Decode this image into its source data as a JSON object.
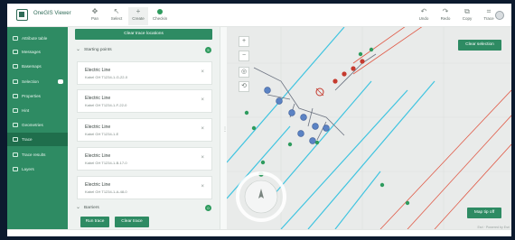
{
  "app": {
    "title": "OneGIS Viewer"
  },
  "toolbar": {
    "tools": [
      {
        "label": "Pan",
        "icon": "pan-icon"
      },
      {
        "label": "Select",
        "icon": "select-icon"
      },
      {
        "label": "Create",
        "icon": "create-icon"
      },
      {
        "label": "Checkin",
        "icon": "checkin-icon"
      }
    ],
    "right_tools": [
      {
        "label": "Undo",
        "icon": "undo-icon"
      },
      {
        "label": "Redo",
        "icon": "redo-icon"
      },
      {
        "label": "Copy",
        "icon": "copy-icon"
      },
      {
        "label": "Trace",
        "icon": "trace-icon"
      }
    ]
  },
  "sidebar": {
    "items": [
      {
        "label": "Attribute table",
        "active": false
      },
      {
        "label": "Messages",
        "active": false
      },
      {
        "label": "Basemaps",
        "active": false
      },
      {
        "label": "Selection",
        "active": false
      },
      {
        "label": "Properties",
        "active": false
      },
      {
        "label": "Hint",
        "active": false
      },
      {
        "label": "Geometries",
        "active": false
      },
      {
        "label": "Trace",
        "active": true
      },
      {
        "label": "Trace results",
        "active": false
      },
      {
        "label": "Layers",
        "active": false
      }
    ]
  },
  "panel": {
    "clear_locations_label": "Clear trace locations",
    "starting_points": {
      "label": "Starting points",
      "count": "5"
    },
    "cards": [
      {
        "title": "Electric Line",
        "subtitle": "Kabel GH T1234-1-G-22-0"
      },
      {
        "title": "Electric Line",
        "subtitle": "Kabel GH T1234-1-F-22-0"
      },
      {
        "title": "Electric Line",
        "subtitle": "Kabel GH T1234-1-E"
      },
      {
        "title": "Electric Line",
        "subtitle": "Kabel GH T1234-1-B-17-0"
      },
      {
        "title": "Electric Line",
        "subtitle": "Kabel GH T1234-1-A-48-0"
      }
    ],
    "barriers": {
      "label": "Barriers",
      "count": "0"
    },
    "run_trace_label": "Run trace",
    "clear_trace_label": "Clear trace"
  },
  "map": {
    "clear_selection_label": "Clear selection",
    "map_tip_label": "Map tip off",
    "attribution": "Esri · Powered by Esri"
  },
  "colors": {
    "brand_green": "#2e8b63",
    "trace_line": "#3fc4e0",
    "barrier_line": "#e05a47"
  }
}
